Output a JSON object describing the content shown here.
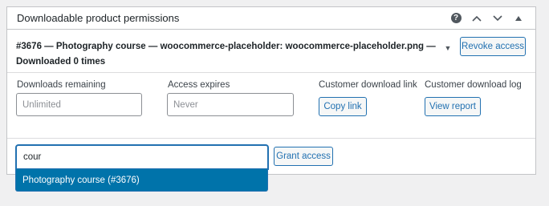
{
  "postbox": {
    "title": "Downloadable product permissions",
    "help_icon_glyph": "?",
    "actions": [
      "help-icon",
      "chevron-up-icon",
      "chevron-down-icon",
      "caret-up-icon"
    ]
  },
  "permission": {
    "title": "#3676 — Photography course — woocommerce-placeholder: woocommerce-placeholder.png — Downloaded 0 times",
    "toggle_icon": "caret-down-icon",
    "revoke_label": "Revoke access"
  },
  "fields": {
    "downloads_remaining": {
      "label": "Downloads remaining",
      "placeholder": "Unlimited",
      "value": ""
    },
    "access_expires": {
      "label": "Access expires",
      "placeholder": "Never",
      "value": ""
    },
    "download_link": {
      "label": "Customer download link",
      "button": "Copy link"
    },
    "download_log": {
      "label": "Customer download log",
      "button": "View report"
    }
  },
  "grant": {
    "search_value": "cour",
    "button_label": "Grant access",
    "results": [
      "Photography course (#3676)"
    ]
  },
  "colors": {
    "accent": "#2271b1",
    "dropdown_highlight": "#0073aa",
    "background": "#f0f0f1"
  }
}
